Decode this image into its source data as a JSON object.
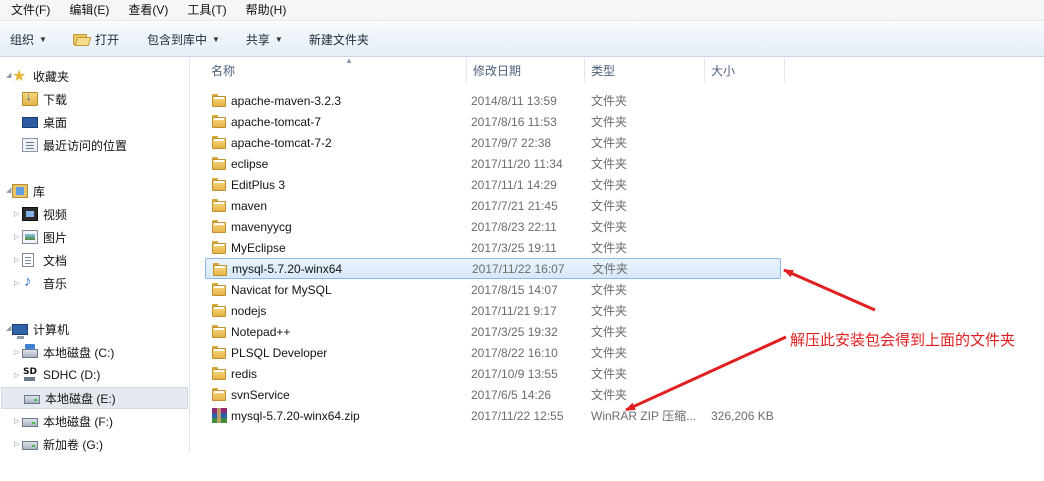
{
  "menubar": {
    "items": [
      {
        "label": "文件(F)"
      },
      {
        "label": "编辑(E)"
      },
      {
        "label": "查看(V)"
      },
      {
        "label": "工具(T)"
      },
      {
        "label": "帮助(H)"
      }
    ]
  },
  "toolbar": {
    "organize": "组织",
    "open": "打开",
    "include_library": "包含到库中",
    "share": "共享",
    "new_folder": "新建文件夹"
  },
  "nav": {
    "favorites": "收藏夹",
    "downloads": "下载",
    "desktop": "桌面",
    "recent": "最近访问的位置",
    "libraries": "库",
    "videos": "视频",
    "pictures": "图片",
    "documents": "文档",
    "music": "音乐",
    "computer": "计算机",
    "drive_c": "本地磁盘 (C:)",
    "drive_d": "SDHC (D:)",
    "drive_e": "本地磁盘 (E:)",
    "drive_f": "本地磁盘 (F:)",
    "drive_g": "新加卷 (G:)"
  },
  "columns": {
    "name": "名称",
    "date": "修改日期",
    "type": "类型",
    "size": "大小"
  },
  "files": [
    {
      "name": "apache-maven-3.2.3",
      "date": "2014/8/11 13:59",
      "type": "文件夹",
      "size": ""
    },
    {
      "name": "apache-tomcat-7",
      "date": "2017/8/16 11:53",
      "type": "文件夹",
      "size": ""
    },
    {
      "name": "apache-tomcat-7-2",
      "date": "2017/9/7 22:38",
      "type": "文件夹",
      "size": ""
    },
    {
      "name": "eclipse",
      "date": "2017/11/20 11:34",
      "type": "文件夹",
      "size": ""
    },
    {
      "name": "EditPlus 3",
      "date": "2017/11/1 14:29",
      "type": "文件夹",
      "size": ""
    },
    {
      "name": "maven",
      "date": "2017/7/21 21:45",
      "type": "文件夹",
      "size": ""
    },
    {
      "name": "mavenyycg",
      "date": "2017/8/23 22:11",
      "type": "文件夹",
      "size": ""
    },
    {
      "name": "MyEclipse",
      "date": "2017/3/25 19:11",
      "type": "文件夹",
      "size": ""
    },
    {
      "name": "mysql-5.7.20-winx64",
      "date": "2017/11/22 16:07",
      "type": "文件夹",
      "size": ""
    },
    {
      "name": "Navicat for MySQL",
      "date": "2017/8/15 14:07",
      "type": "文件夹",
      "size": ""
    },
    {
      "name": "nodejs",
      "date": "2017/11/21 9:17",
      "type": "文件夹",
      "size": ""
    },
    {
      "name": "Notepad++",
      "date": "2017/3/25 19:32",
      "type": "文件夹",
      "size": ""
    },
    {
      "name": "PLSQL Developer",
      "date": "2017/8/22 16:10",
      "type": "文件夹",
      "size": ""
    },
    {
      "name": "redis",
      "date": "2017/10/9 13:55",
      "type": "文件夹",
      "size": ""
    },
    {
      "name": "svnService",
      "date": "2017/6/5 14:26",
      "type": "文件夹",
      "size": ""
    },
    {
      "name": "mysql-5.7.20-winx64.zip",
      "date": "2017/11/22 12:55",
      "type": "WinRAR ZIP 压缩...",
      "size": "326,206 KB"
    }
  ],
  "annotation": {
    "text": "解压此安装包会得到上面的文件夹",
    "color": "#e02020"
  },
  "colors": {
    "selection_border": "#8fb8e8",
    "folder": "#f7d77d"
  }
}
